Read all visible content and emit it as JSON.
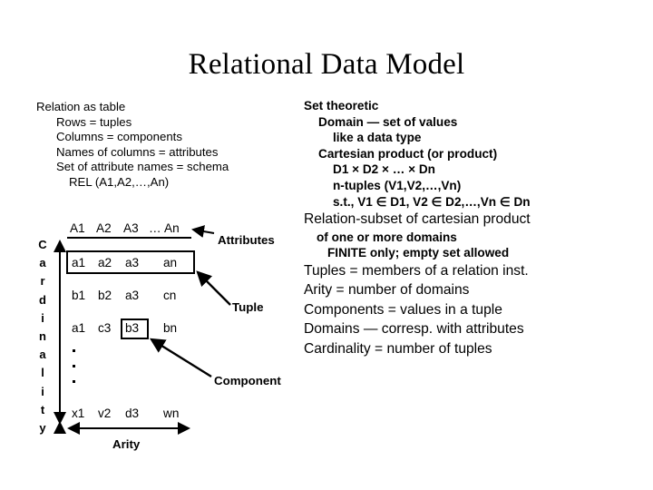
{
  "slide": {
    "title": "Relational Data Model",
    "background_color": "#ffffff",
    "text_color": "#000000"
  },
  "left_bullets": [
    {
      "level": 0,
      "text": "Relation as table"
    },
    {
      "level": 1,
      "text": "Rows = tuples"
    },
    {
      "level": 1,
      "text": "Columns = components"
    },
    {
      "level": 1,
      "text": "Names of columns = attributes"
    },
    {
      "level": 1,
      "text": "Set of attribute names = schema"
    },
    {
      "level": 2,
      "text": "REL (A1,A2,…,An)"
    }
  ],
  "right_bullets": [
    {
      "level": 0,
      "size": "small",
      "text": "Set theoretic"
    },
    {
      "level": 1,
      "size": "small",
      "text": "Domain —  set of values"
    },
    {
      "level": 2,
      "size": "small",
      "text": "like a data type"
    },
    {
      "level": 1,
      "size": "small",
      "text": "Cartesian product (or product)"
    },
    {
      "level": 2,
      "size": "small",
      "text": "D1 × D2 × … × Dn"
    },
    {
      "level": 2,
      "size": "small",
      "text": "n-tuples (V1,V2,…,Vn)"
    },
    {
      "level": 2,
      "size": "small",
      "text": "s.t., V1 ∈ D1, V2 ∈ D2,…,Vn ∈ Dn"
    },
    {
      "level": 0,
      "size": "big",
      "text": "Relation-subset of cartesian product"
    },
    {
      "level": 1,
      "size": "small",
      "text": "of one or more domains"
    },
    {
      "level": 2,
      "size": "small",
      "text": "FINITE only; empty set allowed"
    },
    {
      "level": 0,
      "size": "big",
      "text": "Tuples = members of a relation inst."
    },
    {
      "level": 0,
      "size": "big",
      "text": "Arity = number of domains"
    },
    {
      "level": 0,
      "size": "big",
      "text": "Components = values in a tuple"
    },
    {
      "level": 0,
      "size": "big",
      "text": "Domains — corresp. with attributes"
    },
    {
      "level": 0,
      "size": "big",
      "text": "Cardinality = number of tuples"
    }
  ],
  "diagram": {
    "header_cells": [
      "A1",
      "A2",
      "A3",
      "…",
      "An"
    ],
    "rows": [
      {
        "name": "tuple-row",
        "cells": [
          "a1",
          "a2",
          "a3",
          "an"
        ],
        "boxed": true
      },
      {
        "name": "row-b",
        "cells": [
          "b1",
          "b2",
          "a3",
          "cn"
        ],
        "boxed": false
      },
      {
        "name": "row-c",
        "cells": [
          "a1",
          "c3",
          "b3",
          "bn"
        ],
        "boxed": false
      },
      {
        "name": "row-last",
        "cells": [
          "x1",
          "v2",
          "d3",
          "wn"
        ],
        "boxed": false
      }
    ],
    "ellipsis_dots": 3,
    "vertical_label": "Cardinality",
    "horizontal_label": "Arity",
    "callouts": [
      {
        "name": "attributes",
        "text": "Attributes"
      },
      {
        "name": "tuple",
        "text": "Tuple"
      },
      {
        "name": "component",
        "text": "Component"
      }
    ]
  }
}
